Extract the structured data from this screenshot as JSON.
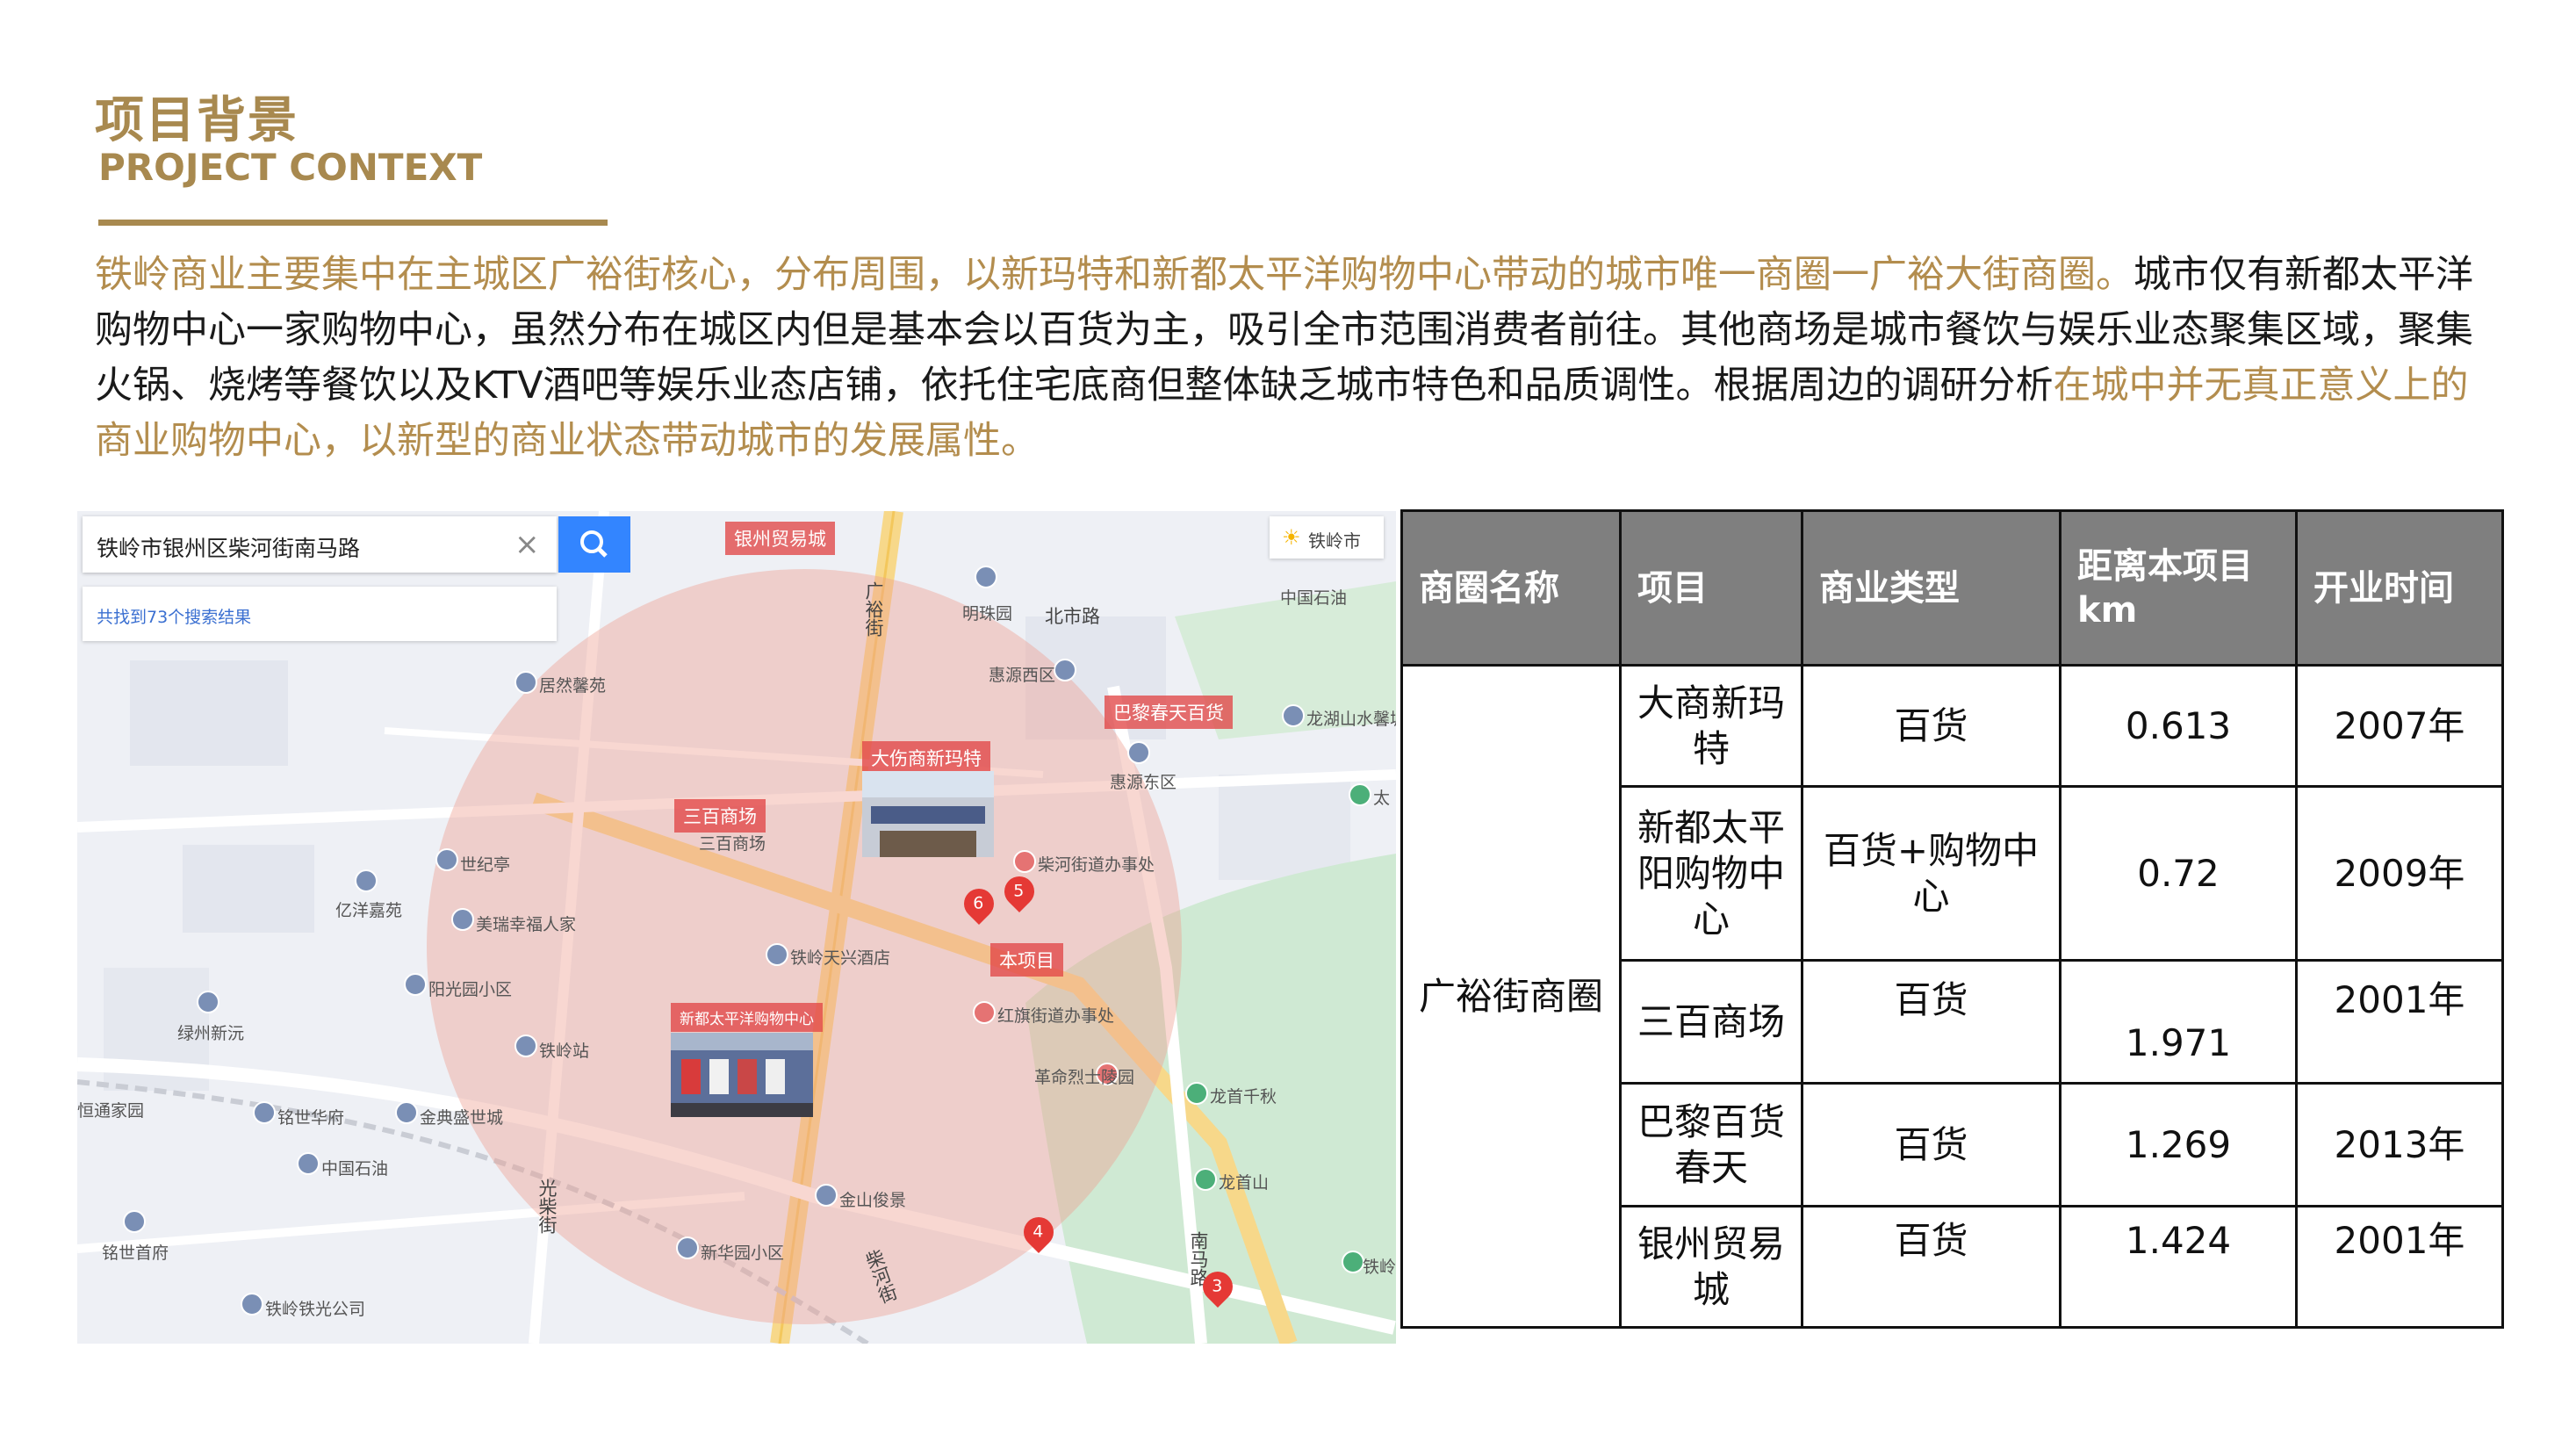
{
  "header": {
    "title_cn": "项目背景",
    "title_en": "PROJECT CONTEXT"
  },
  "body": {
    "p1_highlight": "铁岭商业主要集中在主城区广裕街核心，分布周围，以新玛特和新都太平洋购物中心带动的城市唯一商圈一广裕大街商圈。",
    "p2": "城市仅有新都太平洋购物中心一家购物中心，虽然分布在城区内但是基本会以百货为主，吸引全市范围消费者前往。其他商场是城市餐饮与娱乐业态聚集区域，聚集火锅、烧烤等餐饮以及KTV酒吧等娱乐业态店铺，依托住宅底商但整体缺乏城市特色和品质调性。根据周边的调研分析",
    "p3_highlight": "在城中并无真正意义上的商业购物中心，以新型的商业状态带动城市的发展属性。"
  },
  "map": {
    "search_query": "铁岭市银州区柴河街南马路",
    "result_count": "共找到73个搜索结果",
    "city": "铁岭市",
    "labels": {
      "yinzhou": "银州贸易城",
      "guangyu": "广裕街",
      "mingzhu": "明珠园",
      "beishi": "北市路",
      "zhongguo_shiyou_1": "中国石油",
      "huiyuan_xi": "惠源西区",
      "juran": "居然馨苑",
      "longhu": "龙湖山水馨城",
      "bali_tag": "巴黎春天百货",
      "bali_sub": "巴黎春天百货",
      "huiyuan_dong": "惠源东区",
      "dashang_tag": "大伤商新玛特",
      "sanbai_tag": "三百商场",
      "sanbai_sub": "三百商场",
      "chaihe_office": "柴河街道办事处",
      "shijiting": "世纪亭",
      "yiyang": "亿洋嘉苑",
      "meijing": "美瑞幸福人家",
      "tieling_tianxing": "铁岭天兴酒店",
      "benxiangmu": "本项目",
      "hongqi": "红旗街道办事处",
      "xindu_tag": "新都太平洋购物中心",
      "yangguang": "阳光园小区",
      "lvxin": "绿州新沅",
      "tieling_station": "铁岭站",
      "lieshi": "革命烈士陵园",
      "longshou_qianqiu": "龙首千秋",
      "hengtong": "恒通家园",
      "mingshi": "铭世华府",
      "jindian": "金典盛世城",
      "zhongguo_shiyou_2": "中国石油",
      "longshou_shan": "龙首山",
      "jinshan": "金山俊景",
      "mingshi_shoufu": "铭世首府",
      "guangchai": "光柴街",
      "xinhua": "新华园小区",
      "nanma": "南马路",
      "chaihe_jie": "柴河街",
      "tieling_tieguang": "铁岭铁光公司",
      "tai": "太",
      "tieling_edge": "铁岭"
    },
    "markers": [
      "6",
      "5",
      "4",
      "3"
    ]
  },
  "table": {
    "headers": [
      "商圈名称",
      "项目",
      "商业类型",
      "距离本项目km",
      "开业时间"
    ],
    "district": "广裕街商圈",
    "rows": [
      {
        "project": "大商新玛特",
        "type": "百货",
        "distance": "0.613",
        "year": "2007年"
      },
      {
        "project": "新都太平阳购物中心",
        "type": "百货+购物中心",
        "distance": "0.72",
        "year": "2009年"
      },
      {
        "project": "三百商场",
        "type": "百货",
        "distance": "1.971",
        "year": "2001年"
      },
      {
        "project": "巴黎百货春天",
        "type": "百货",
        "distance": "1.269",
        "year": "2013年"
      },
      {
        "project": "银州贸易城",
        "type": "百货",
        "distance": "1.424",
        "year": "2001年"
      }
    ]
  },
  "colors": {
    "accent": "#a8894f",
    "header_fill": "#7f7f7f",
    "circle": "#efa092",
    "search_blue": "#3385ff"
  }
}
